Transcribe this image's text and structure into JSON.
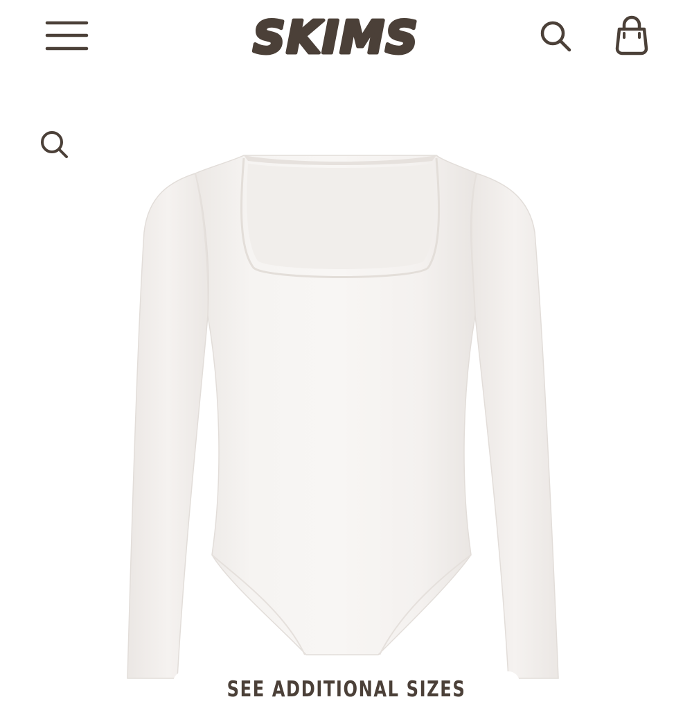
{
  "header": {
    "logo_text": "SKIMS",
    "menu_icon": "hamburger-menu-icon",
    "search_icon": "search-icon",
    "bag_icon": "shopping-bag-icon"
  },
  "product": {
    "image_alt": "long sleeve square neck bodysuit",
    "zoom_icon": "zoom-search-icon",
    "see_sizes_label": "SEE ADDITIONAL SIZES"
  },
  "colors": {
    "brand": "#4b4038",
    "background": "#ffffff",
    "garment": "#f4f1ef"
  }
}
